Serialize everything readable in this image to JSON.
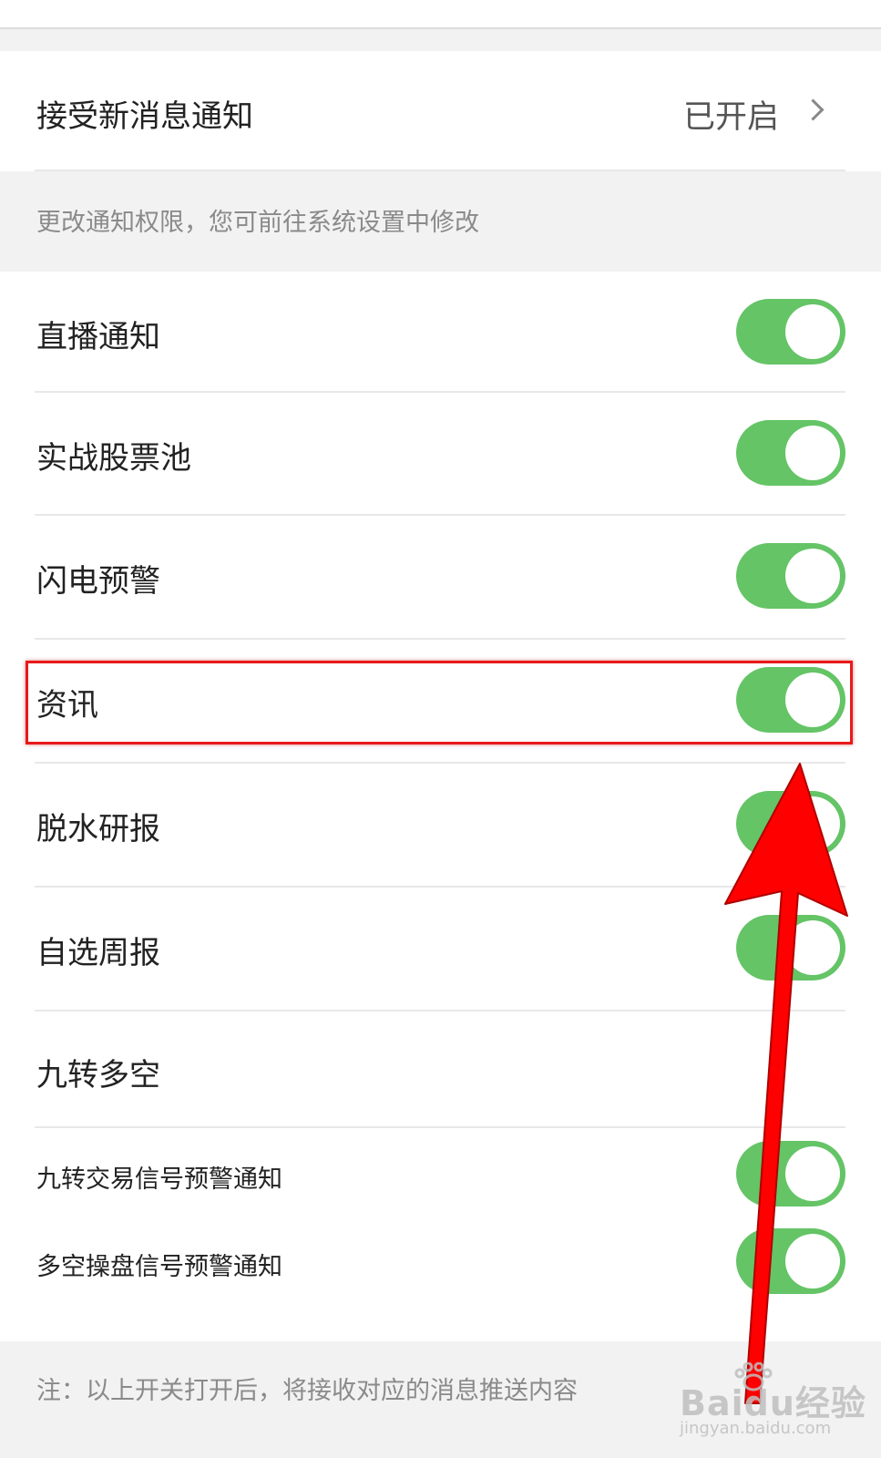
{
  "notification": {
    "label": "接受新消息通知",
    "status": "已开启"
  },
  "hint": "更改通知权限，您可前往系统设置中修改",
  "toggles": [
    {
      "label": "直播通知",
      "on": true
    },
    {
      "label": "实战股票池",
      "on": true
    },
    {
      "label": "闪电预警",
      "on": true
    },
    {
      "label": "资讯",
      "on": true
    },
    {
      "label": "脱水研报",
      "on": true
    },
    {
      "label": "自选周报",
      "on": true
    }
  ],
  "group": {
    "title": "九转多空",
    "items": [
      {
        "label": "九转交易信号预警通知",
        "on": true
      },
      {
        "label": "多空操盘信号预警通知",
        "on": true
      }
    ]
  },
  "footer_note": "注：以上开关打开后，将接收对应的消息推送内容",
  "watermark": {
    "main": "Baidu经验",
    "sub": "jingyan.baidu.com"
  },
  "colors": {
    "toggle_on": "#64c466",
    "annotation_red": "#e8191b"
  }
}
